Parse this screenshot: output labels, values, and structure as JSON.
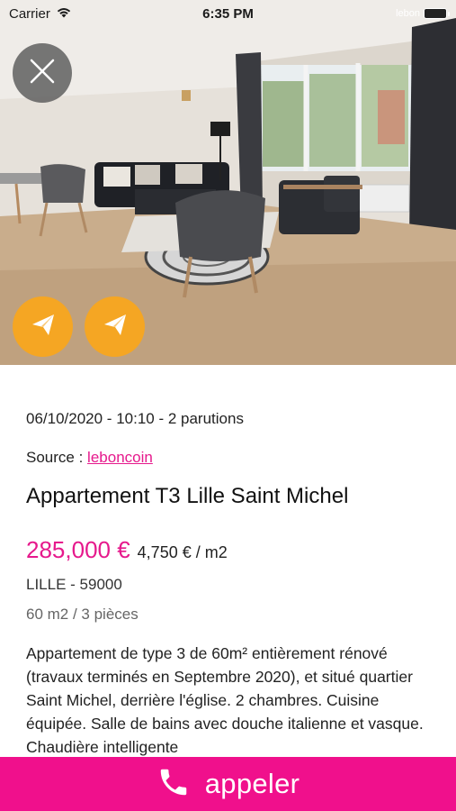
{
  "status_bar": {
    "carrier": "Carrier",
    "time": "6:35 PM",
    "watermark": "lebon"
  },
  "photo": {
    "description_icon": "apartment-photo"
  },
  "listing": {
    "meta": "06/10/2020 - 10:10 - 2 parutions",
    "source_label": "Source : ",
    "source_link": "leboncoin",
    "title": "Appartement T3 Lille Saint Michel",
    "price": "285,000 €",
    "price_per_m2": "4,750 € / m2",
    "city": "LILLE - 59000",
    "specs": "60 m2 / 3 pièces",
    "description": "Appartement de type 3 de 60m² entièrement rénové (travaux terminés en Septembre 2020), et situé quartier Saint Michel, derrière l'église. 2 chambres. Cuisine équipée. Salle de bains avec douche italienne et vasque. Chaudière intelligente"
  },
  "actions": {
    "call_label": "appeler"
  },
  "colors": {
    "accent": "#e6198c",
    "call_bar": "#f0108c",
    "share_button": "#f5a623"
  }
}
